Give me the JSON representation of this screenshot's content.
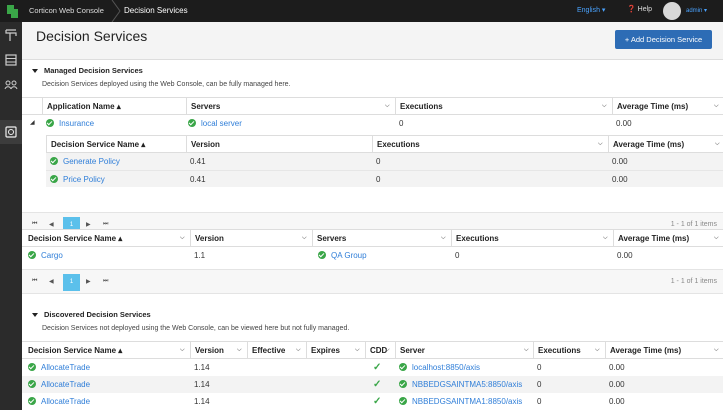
{
  "app": {
    "brand": "Corticon Web Console",
    "breadcrumb": "Decision Services",
    "language": "English ▾",
    "help": "Help",
    "user": "admin ▾"
  },
  "page": {
    "title": "Decision Services",
    "add_button": "+ Add Decision Service"
  },
  "managed": {
    "title": "Managed Decision Services",
    "description": "Decision Services deployed using the Web Console, can be fully managed here.",
    "app_headers": [
      "Application Name ▴",
      "Servers",
      "Executions",
      "Average Time (ms)"
    ],
    "app_row": {
      "name": "Insurance",
      "server": "local server",
      "executions": "0",
      "avg": "0.00"
    },
    "ds_headers": [
      "Decision Service Name ▴",
      "Version",
      "Executions",
      "Average Time (ms)"
    ],
    "ds_rows": [
      {
        "name": "Generate Policy",
        "version": "0.41",
        "executions": "0",
        "avg": "0.00"
      },
      {
        "name": "Price Policy",
        "version": "0.41",
        "executions": "0",
        "avg": "0.00"
      }
    ],
    "pager": {
      "page": "1",
      "info": "1 - 1 of 1 items"
    },
    "standalone_headers": [
      "Decision Service Name ▴",
      "Version",
      "Servers",
      "Executions",
      "Average Time (ms)"
    ],
    "standalone_row": {
      "name": "Cargo",
      "version": "1.1",
      "server": "QA Group",
      "executions": "0",
      "avg": "0.00"
    },
    "pager2": {
      "page": "1",
      "info": "1 - 1 of 1 items"
    }
  },
  "discovered": {
    "title": "Discovered Decision Services",
    "description": "Decision Services not deployed using the Web Console, can be viewed here but not fully managed.",
    "headers": [
      "Decision Service Name ▴",
      "Version",
      "Effective",
      "Expires",
      "CDD",
      "Server",
      "Executions",
      "Average Time (ms)"
    ],
    "rows": [
      {
        "name": "AllocateTrade",
        "version": "1.14",
        "server": "localhost:8850/axis",
        "executions": "0",
        "avg": "0.00"
      },
      {
        "name": "AllocateTrade",
        "version": "1.14",
        "server": "NBBEDGSAINTMA5:8850/axis",
        "executions": "0",
        "avg": "0.00"
      },
      {
        "name": "AllocateTrade",
        "version": "1.14",
        "server": "NBBEDGSAINTMA1:8850/axis",
        "executions": "0",
        "avg": "0.00"
      }
    ]
  },
  "pager_icons": [
    "first-page-icon",
    "prev-page-icon",
    "next-page-icon",
    "last-page-icon"
  ],
  "colors": {
    "accent": "#2d6cb5",
    "link": "#2f7ed8",
    "success": "#3aa648",
    "topbar": "#1c1c1c"
  }
}
